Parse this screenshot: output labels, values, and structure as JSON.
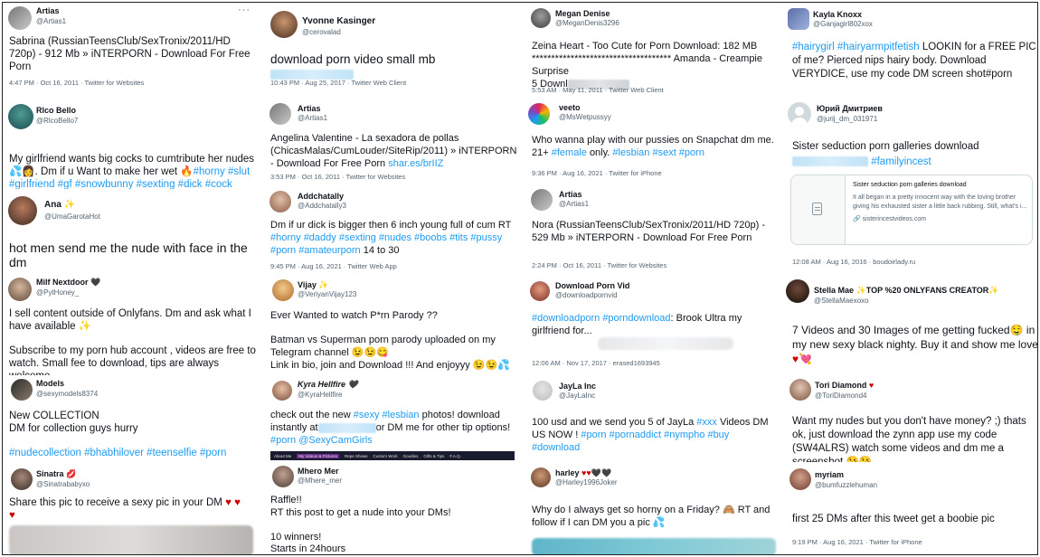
{
  "cards": {
    "c1": {
      "name": "Artias",
      "handle": "@Artias1",
      "text": "Sabrina (RussianTeensClub/SexTronix/2011/HD 720p) - 912 Mb » iNTERPORN - Download For Free Porn",
      "time": "4:47 PM · Oct 16, 2011 · Twitter for Websites"
    },
    "c2": {
      "name": "Rlco Bello",
      "handle": "@RlcoBello7",
      "text": "My girlfriend wants big cocks to cumtribute her nudes",
      "text2": ". Dm if u Want to make her wet",
      "tags1": "#horny #slut",
      "tags2": "#girlfriend #gf #snowbunny #sexting #dick #cock"
    },
    "c3": {
      "name": "Ana",
      "handle": "@UmaGarotaHot",
      "text": "hot men send me the nude with face in the dm"
    },
    "c4": {
      "name": "Milf Nextdoor",
      "handle": "@PytHoney_",
      "text": "I sell content outside of Onlyfans. Dm and ask what I have available",
      "text2": "Subscribe to my porn hub account , videos are free to watch. Small fee to download, tips are always welcome"
    },
    "c5": {
      "name": "Models",
      "handle": "@sexymodels8374",
      "text": "New COLLECTION\nDM for collection guys hurry",
      "tags": "#nudecollection #bhabhilover #teenselfie #porn"
    },
    "c6": {
      "name": "Sinatra",
      "handle": "@Sinatrababyxo",
      "text": "Share this pic to receive a sexy pic in your DM"
    },
    "c7": {
      "name": "Yvonne Kasinger",
      "handle": "@cerovalad",
      "text": "download porn video small mb",
      "time": "10:43 PM · Aug 25, 2017 · Twitter Web Client"
    },
    "c8": {
      "name": "Artias",
      "handle": "@Artias1",
      "text": "Angelina Valentine - La sexadora de pollas (ChicasMalas/CumLouder/SiteRip/2011) » iNTERPORN - Download For Free Porn",
      "link": "shar.es/brIIZ",
      "time": "3:53 PM · Oct 16, 2011 · Twitter for Websites"
    },
    "c9": {
      "name": "Addchatally",
      "handle": "@Addchatally3",
      "text": "Dm if ur dick is bigger then 6 inch young full of cum RT",
      "tags": "#horny #daddy #sexting #nudes #boobs #tits #pussy",
      "tags2": "#porn #amateurporn",
      "tail": "14 to 30",
      "time": "9:45 PM · Aug 16, 2021 · Twitter Web App"
    },
    "c10": {
      "name": "Vijay",
      "handle": "@VeriyanVijay123",
      "text": "Ever Wanted to watch P*rn Parody ??",
      "text2": "Batman vs Superman porn parody uploaded on my Telegram channel",
      "text3": "Link in bio, join and Download !!! And enjoyyy"
    },
    "c11": {
      "name": "Kyra Hellfire",
      "handle": "@KyraHellfire",
      "pre": "check out the new",
      "tags": "#sexy #lesbian",
      "post": "photos! download instantly at",
      "post2": "or DM me for other tip options!",
      "tags2": "#porn @SexyCamGirls",
      "nav": [
        "About Me",
        "My Videos & Pictures",
        "Repe Shows",
        "Custom Work",
        "Goodies",
        "Gifts & Tips",
        "F.A.Q."
      ]
    },
    "c12": {
      "name": "Mhero Mer",
      "handle": "@Mhere_mer",
      "text": "Raffle!!\nRT this post to get a nude into your DMs!\n\n10 winners!\nStarts in 24hours"
    },
    "c13": {
      "name": "Megan Denise",
      "handle": "@MeganDenis3296",
      "text": "Zeina Heart - Too Cute for Porn Download: 182 MB",
      "stars": "************************************",
      "text2": "Amanda - Creampie Surprise",
      "text3": "5 Downl",
      "time": "5:53 AM · May 11, 2011 · Twitter Web Client"
    },
    "c14": {
      "name": "veeto",
      "handle": "@MsWetpussyy",
      "text": "Who wanna play with our pussies on Snapchat dm me. 21+",
      "tags": "#female",
      "mid": "only.",
      "tags2": "#lesbian #sext #porn",
      "time": "9:36 PM · Aug 16, 2021 · Twitter for iPhone"
    },
    "c15": {
      "name": "Artias",
      "handle": "@Artias1",
      "text": "Nora (RussianTeensClub/SexTronix/2011/HD 720p) - 529 Mb » iNTERPORN - Download For Free Porn",
      "time": "2:24 PM · Oct 16, 2011 · Twitter for Websites"
    },
    "c16": {
      "name": "Download Porn Vid",
      "handle": "@downloadpornvid",
      "tags": "#downloadporn #porndownload",
      "text": ": Brook Ultra my girlfriend for...",
      "time": "12:06 AM · Nov 17, 2017 · erased1693945"
    },
    "c17": {
      "name": "JayLa Inc",
      "handle": "@JayLaInc",
      "text": "100 usd and we  send you 5 of JayLa",
      "tags": "#xxx",
      "text2": "Videos DM US NOW !",
      "tags2": "#porn #pornaddict #nympho #buy",
      "tags3": "#download"
    },
    "c18": {
      "name": "harley",
      "handle": "@Harley1996Joker",
      "text": "Why do I always get so horny on a Friday?",
      "text2": "RT and follow if I can DM you a pic"
    },
    "c19": {
      "name": "Kayla Knoxx",
      "handle": "@Ganjagirl802xox",
      "tags": "#hairygirl #hairyarmpitfetish",
      "text": "LOOKIN for a FREE PIC of me? Pierced nips hairy body. Download VERYDICE, use my code DM screen shot#porn"
    },
    "c20": {
      "name": "Юрий Дмитриев",
      "handle": "@jurij_dm_031971",
      "text": "Sister seduction porn galleries download",
      "tags": "#familyincest",
      "card_title": "Sister seduction porn galleries download",
      "card_desc": "It all began in a pretty innocent way with the loving brother giving his exhausted sister a little back rubbing. Still, what's i...",
      "card_domain": "sisterincestvideos.com",
      "time": "12:08 AM · Aug 16, 2016 · boudoirlady.ru"
    },
    "c21": {
      "name": "Stella Mae",
      "badge": "TOP %20 ONLYFANS CREATOR",
      "handle": "@StellaMaexoxo",
      "text": "7 Videos and 30 Images of me getting fucked",
      "text2": "in my new sexy black nighty. Buy it and show me love"
    },
    "c22": {
      "name": "Tori Diamond",
      "handle": "@ToriDiamond4",
      "text": "Want my nudes but you don't have money? ;) thats ok, just download the zynn app use my code (SW4ALRS) watch some videos and dm me a screenshot"
    },
    "c23": {
      "name": "myriam",
      "handle": "@bumfuzzlehuman",
      "text": "first 25 DMs after this tweet get a boobie pic",
      "time": "9:19 PM · Aug 16, 2021 · Twitter for iPhone"
    }
  },
  "icons": {
    "more": "more-dots-icon",
    "verified": "black-heart-icon"
  },
  "colors": {
    "link": "#1d9bf0",
    "muted": "#536471",
    "text": "#0f1419"
  }
}
